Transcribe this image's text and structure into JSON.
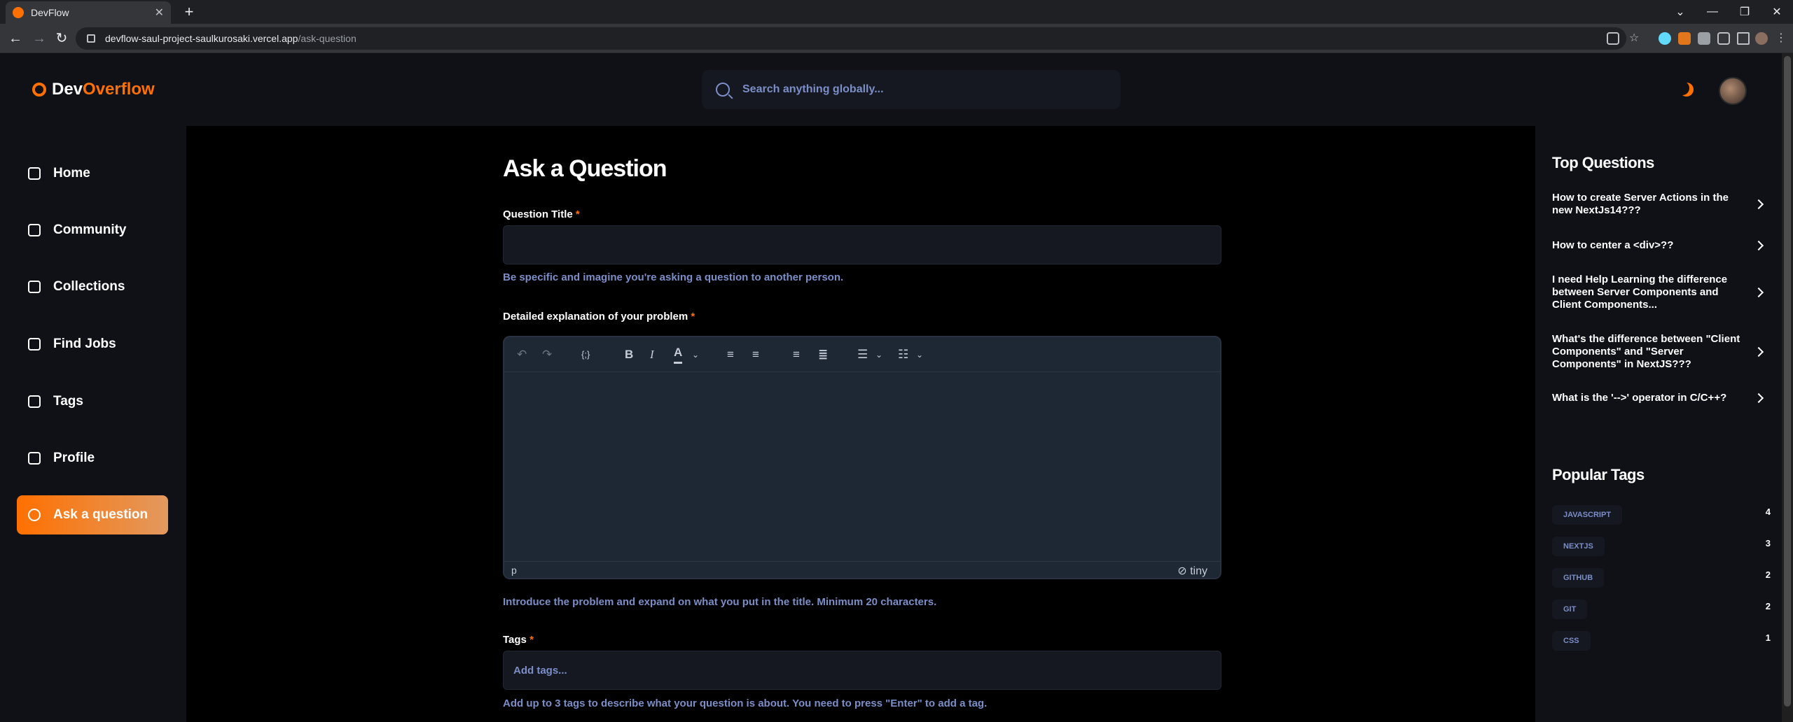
{
  "browser": {
    "tab_title": "DevFlow",
    "url_host": "devflow-saul-project-saulkurosaki.vercel.app",
    "url_path": "/ask-question"
  },
  "header": {
    "logo_dev": "Dev",
    "logo_overflow": "Overflow",
    "search_placeholder": "Search anything globally..."
  },
  "sidebar": {
    "items": [
      {
        "label": "Home",
        "icon": "home-icon"
      },
      {
        "label": "Community",
        "icon": "users-icon"
      },
      {
        "label": "Collections",
        "icon": "star-icon"
      },
      {
        "label": "Find Jobs",
        "icon": "suitcase-icon"
      },
      {
        "label": "Tags",
        "icon": "tag-icon"
      },
      {
        "label": "Profile",
        "icon": "user-icon"
      },
      {
        "label": "Ask a question",
        "icon": "question-icon",
        "active": true
      }
    ]
  },
  "form": {
    "title": "Ask a Question",
    "question_title_label": "Question Title",
    "required_mark": "*",
    "question_title_hint": "Be specific and imagine you're asking a question to another person.",
    "explanation_label": "Detailed explanation of your problem",
    "editor_status_element": "p",
    "editor_brand": "tiny",
    "explanation_hint": "Introduce the problem and expand on what you put in the title. Minimum 20 characters.",
    "tags_label": "Tags",
    "tags_placeholder": "Add tags...",
    "tags_hint": "Add up to 3 tags to describe what your question is about. You need to press \"Enter\" to add a tag."
  },
  "right_sidebar": {
    "top_questions_title": "Top Questions",
    "top_questions": [
      "How to create Server Actions in the new NextJs14???",
      "How to center a <div>??",
      "I need Help Learning the difference between Server Components and Client Components...",
      "What's the difference between \"Client Components\" and \"Server Components\" in NextJS???",
      "What is the '-->' operator in C/C++?"
    ],
    "popular_tags_title": "Popular Tags",
    "popular_tags": [
      {
        "name": "JAVASCRIPT",
        "count": "4"
      },
      {
        "name": "NEXTJS",
        "count": "3"
      },
      {
        "name": "GITHUB",
        "count": "2"
      },
      {
        "name": "GIT",
        "count": "2"
      },
      {
        "name": "CSS",
        "count": "1"
      }
    ]
  },
  "colors": {
    "accent": "#ff7000",
    "hint": "#7b8ec8",
    "panel": "#0f1117",
    "input": "#151821"
  }
}
